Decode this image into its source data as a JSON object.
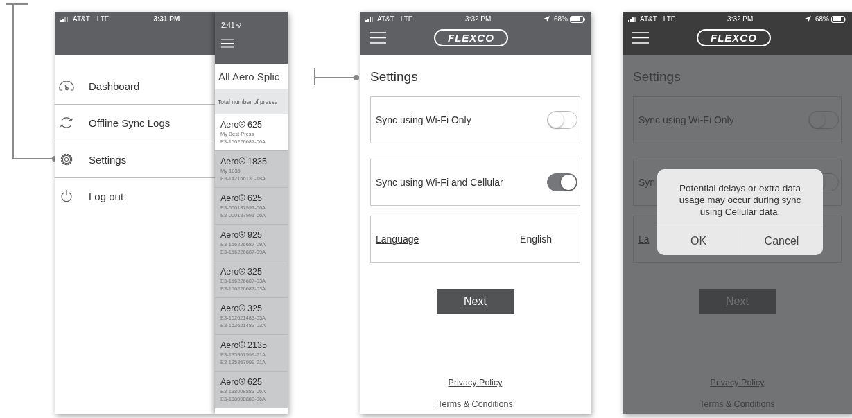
{
  "screens": [
    {
      "kind": "menu",
      "status": {
        "carrier": "AT&T",
        "network": "LTE",
        "time": "3:31 PM"
      },
      "menu": [
        {
          "label": "Dashboard"
        },
        {
          "label": "Offline Sync Logs"
        },
        {
          "label": "Settings"
        },
        {
          "label": "Log out"
        }
      ],
      "panel": {
        "time": "2:41",
        "title": "All Aero Splic",
        "summary": "Total number of presse",
        "items": [
          {
            "name": "Aero® 625",
            "lines": [
              "My Best Press",
              "E3-156226687-06A"
            ],
            "selected": true
          },
          {
            "name": "Aero® 1835",
            "lines": [
              "My 1835",
              "E3-142156130-18A"
            ],
            "selected": false
          },
          {
            "name": "Aero® 625",
            "lines": [
              "E3-000137991-06A",
              "E3-000137991-06A"
            ],
            "selected": false
          },
          {
            "name": "Aero® 925",
            "lines": [
              "E3-156226687-09A",
              "E3-156226687-09A"
            ],
            "selected": false
          },
          {
            "name": "Aero® 325",
            "lines": [
              "E3-156226687-03A",
              "E3-156226687-03A"
            ],
            "selected": false
          },
          {
            "name": "Aero® 325",
            "lines": [
              "E3-162621483-03A",
              "E3-162621483-03A"
            ],
            "selected": false
          },
          {
            "name": "Aero® 2135",
            "lines": [
              "E3-135367999-21A",
              "E3-135367999-21A"
            ],
            "selected": false
          },
          {
            "name": "Aero® 625",
            "lines": [
              "E3-138008883-06A",
              "E3-138008883-06A"
            ],
            "selected": false
          }
        ]
      }
    },
    {
      "kind": "settings",
      "status": {
        "carrier": "AT&T",
        "network": "LTE",
        "time": "3:32 PM",
        "battery": "68%"
      },
      "logo": "FLEXCO",
      "title": "Settings",
      "rows": [
        {
          "kind": "toggle",
          "label": "Sync using Wi-Fi Only",
          "on": false
        },
        {
          "kind": "toggle",
          "label": "Sync using Wi-Fi and Cellular",
          "on": true
        },
        {
          "kind": "link",
          "label": "Language",
          "value": "English"
        }
      ],
      "button": "Next",
      "links": [
        "Privacy Policy",
        "Terms & Conditions"
      ]
    },
    {
      "kind": "settings",
      "status": {
        "carrier": "AT&T",
        "network": "LTE",
        "time": "3:32 PM",
        "battery": "68%"
      },
      "logo": "FLEXCO",
      "title": "Settings",
      "rows": [
        {
          "kind": "toggle",
          "label": "Sync using Wi-Fi Only",
          "on": false
        },
        {
          "kind": "toggle",
          "label": "Syn",
          "on": false
        },
        {
          "kind": "link",
          "label": "La"
        }
      ],
      "button": "Next",
      "links": [
        "Privacy Policy",
        "Terms & Conditions"
      ],
      "dialog": {
        "message": "Potential delays or extra data usage may occur during sync using Cellular data.",
        "buttons": [
          "OK",
          "Cancel"
        ]
      }
    }
  ]
}
